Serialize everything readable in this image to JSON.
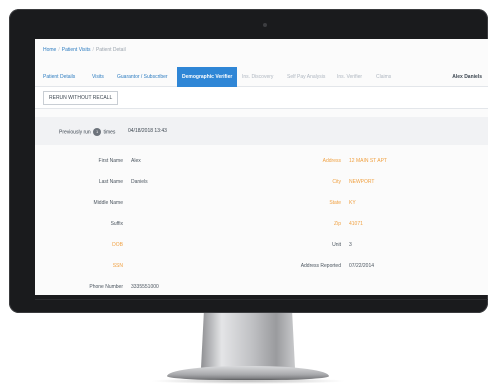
{
  "breadcrumb": {
    "home": "Home",
    "patient_visits": "Patient Visits",
    "patient_detail": "Patient Detail"
  },
  "tabs": [
    {
      "label": "Patient Details",
      "state": "link"
    },
    {
      "label": "Visits",
      "state": "link"
    },
    {
      "label": "Guarantor / Subscriber",
      "state": "link"
    },
    {
      "label": "Demographic Verifier",
      "state": "active"
    },
    {
      "label": "Ins. Discovery",
      "state": "disabled"
    },
    {
      "label": "Self Pay Analysis",
      "state": "disabled"
    },
    {
      "label": "Ins. Verifier",
      "state": "disabled"
    },
    {
      "label": "Claims",
      "state": "disabled"
    }
  ],
  "user": {
    "name": "Alex Daniels"
  },
  "toolbar": {
    "rerun_label": "RERUN WITHOUT RECALL"
  },
  "run_info": {
    "prefix": "Previously run",
    "count": "1",
    "suffix": "times",
    "date": "04/18/2018 13:43"
  },
  "fields_left": [
    {
      "label": "First Name",
      "value": "Alex",
      "warn": false
    },
    {
      "label": "Last Name",
      "value": "Daniels",
      "warn": false
    },
    {
      "label": "Middle Name",
      "value": "",
      "warn": false
    },
    {
      "label": "Suffix",
      "value": "",
      "warn": false
    },
    {
      "label": "DOB",
      "value": "",
      "warn": true
    },
    {
      "label": "SSN",
      "value": "",
      "warn": true
    },
    {
      "label": "Phone Number",
      "value": "3335551000",
      "warn": false
    }
  ],
  "fields_right": [
    {
      "label": "Address",
      "value": "12 MAIN ST APT",
      "warn": true
    },
    {
      "label": "City",
      "value": "NEWPORT",
      "warn": true
    },
    {
      "label": "State",
      "value": "KY",
      "warn": true
    },
    {
      "label": "Zip",
      "value": "41071",
      "warn": true
    },
    {
      "label": "Unit",
      "value": "3",
      "warn": false
    },
    {
      "label": "Address Reported",
      "value": "07/22/2014",
      "warn": false
    }
  ],
  "colors": {
    "accent": "#2f86d6",
    "link": "#2e7dc1",
    "warning": "#f0a040",
    "bezel": "#1a1b1d"
  }
}
